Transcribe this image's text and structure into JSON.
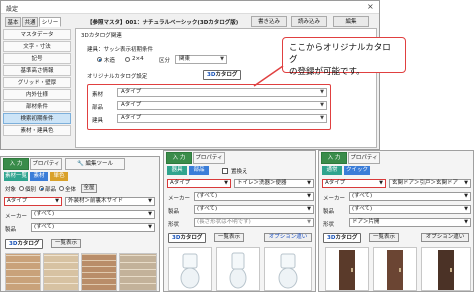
{
  "dialog": {
    "title": "設定",
    "close_glyph": "×",
    "tabs": [
      "基本",
      "共通",
      "シリーズ"
    ],
    "header_title": "【参照マスタ】001：ナチュラルベーシック(3Dカタログ版)",
    "buttons": {
      "write": "書き込み",
      "read": "読み込み",
      "edit": "編集"
    },
    "sidebar": [
      "マスタデータ",
      "文字・寸法",
      "記号",
      "基準高さ情報",
      "グリッド・壁厚",
      "内外仕様",
      "部材条件",
      "検索初期条件",
      "素材・建具色"
    ],
    "selected_sidebar": "検索初期条件",
    "section_catalog": "3Dカタログ関連",
    "sash_label": "建具：サッシ表示初期条件",
    "radio_wood": "木造",
    "radio_2x4": "2×4",
    "division_label": "区分",
    "division_value": "関東",
    "orig_catalog_label": "オリジナルカタログ設定",
    "catalog_btn_prefix": "3D",
    "catalog_btn_suffix": "カタログ",
    "rows": [
      {
        "label": "素材",
        "value": "Aタイプ"
      },
      {
        "label": "部品",
        "value": "Aタイプ"
      },
      {
        "label": "建具",
        "value": "Aタイプ"
      }
    ]
  },
  "callout": {
    "line1": "ここからオリジナルカタログ",
    "line2": "の登録が可能です。"
  },
  "panel_material": {
    "tabs": [
      "入 力",
      "プロパティ",
      "編集ツール"
    ],
    "subtabs": [
      "素材一覧",
      "素材",
      "単色"
    ],
    "target_label": "対象",
    "radios": [
      "個別",
      "部品",
      "全体"
    ],
    "full_btn": "全屋",
    "type_value": "Aタイプ",
    "location_value": "外装材＞前裏木サイド",
    "maker_label": "メーカー",
    "maker_value": "(すべて)",
    "product_label": "製品",
    "product_value": "(すべて)",
    "list_btn": "一覧表示"
  },
  "panel_parts": {
    "tabs": [
      "入 力",
      "プロパティ"
    ],
    "subtabs": [
      "器具",
      "部品"
    ],
    "replace_label": "置換え",
    "type_value": "Aタイプ",
    "category_value": "トイレ＞洗器＞便器",
    "maker_label": "メーカー",
    "maker_value": "(すべて)",
    "product_label": "製品",
    "product_value": "(すべて)",
    "shape_label": "形状",
    "shape_value": "(長さ形状は不明です)",
    "list_btn": "一覧表示",
    "option_btn": "オプション違い"
  },
  "panel_fitting": {
    "tabs": [
      "入 力",
      "プロパティ"
    ],
    "subtabs": [
      "通常",
      "クイック"
    ],
    "type_value": "Aタイプ",
    "category_value": "玄関ドア＞引戸＞玄関ドア",
    "maker_label": "メーカー",
    "maker_value": "(すべて)",
    "product_label": "製品",
    "product_value": "(すべて)",
    "shape_label": "形状",
    "shape_value": "ドア＞片開",
    "list_btn": "一覧表示",
    "option_btn": "オプション違い"
  },
  "colors": {
    "accent_red": "#e04040",
    "tab_green": "#3a8c4a",
    "subtab_teal": "#2fa48e",
    "subtab_blue": "#3b7dd8",
    "selection_blue": "#cce4f7"
  }
}
